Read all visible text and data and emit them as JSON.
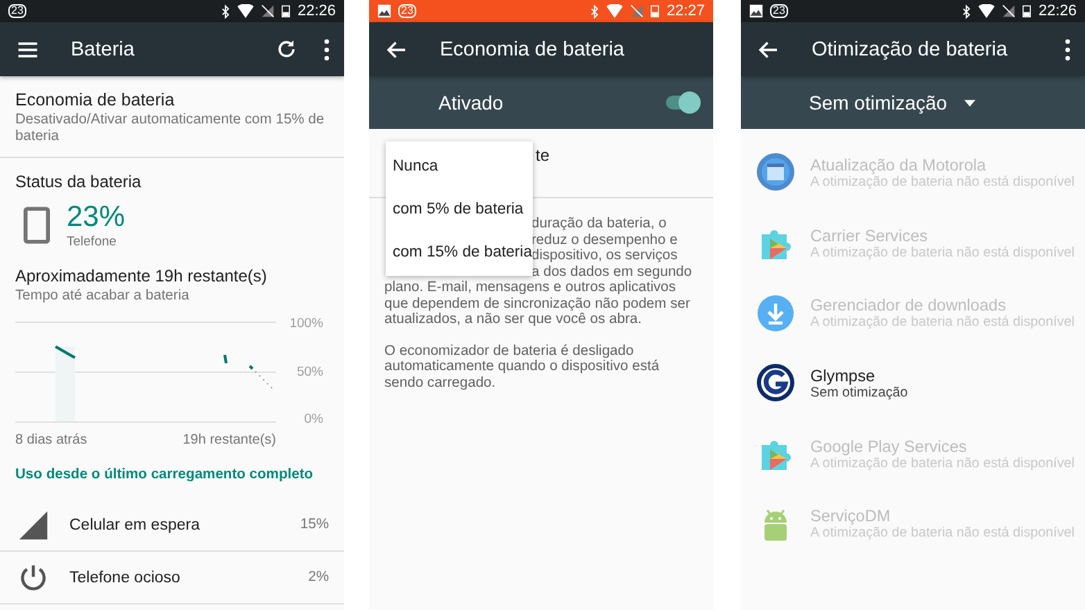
{
  "screens": [
    {
      "kind": "battery",
      "status_bar": {
        "saver": false,
        "notifications": [
          {
            "kind": "count",
            "text": "23"
          }
        ],
        "time": "22:26"
      },
      "app_bar": {
        "nav": {
          "kind": "menu"
        },
        "title": "Bateria",
        "actions": [
          {
            "kind": "refresh"
          },
          {
            "kind": "more"
          }
        ]
      },
      "saver_item": {
        "title": "Economia de bateria",
        "subtitle": "Desativado/Ativar automaticamente com 15% de bateria"
      },
      "status": {
        "heading": "Status da bateria",
        "percent": "23%",
        "device": "Telefone"
      },
      "remaining": {
        "title": "Aproximadamente 19h restante(s)",
        "subtitle": "Tempo até acabar a bateria"
      },
      "graph": {
        "y_labels": [
          "100%",
          "50%",
          "0%"
        ],
        "x_labels": [
          "8 dias atrás",
          "19h restante(s)"
        ]
      },
      "usage_heading": "Uso desde o último carregamento completo",
      "usage": [
        {
          "kind": "signal",
          "name": "Celular em espera",
          "percent": "15%"
        },
        {
          "kind": "power",
          "name": "Telefone ocioso",
          "percent": "2%"
        }
      ]
    },
    {
      "kind": "saver",
      "status_bar": {
        "saver": true,
        "notifications": [
          {
            "kind": "image"
          },
          {
            "kind": "count",
            "text": "23"
          }
        ],
        "time": "22:27"
      },
      "app_bar": {
        "nav": {
          "kind": "back"
        },
        "title": "Economia de bateria"
      },
      "master": {
        "label": "Ativado",
        "on": true
      },
      "row_fragment": "te",
      "paragraph_fragments": [
        "duração da bateria, o",
        "reduz o desempenho e",
        "dispositivo, os serviços",
        "a dos dados em segundo"
      ],
      "paragraph_rest": [
        "plano. E-mail, mensagens e outros aplicativos",
        "que dependem de sincronização não podem ser",
        "atualizados, a não ser que você os abra."
      ],
      "paragraph2": "O economizador de bateria é desligado automaticamente quando o dispositivo está sendo carregado.",
      "menu": [
        "Nunca",
        "com 5% de bateria",
        "com 15% de bateria"
      ]
    },
    {
      "kind": "optimization",
      "status_bar": {
        "saver": false,
        "notifications": [
          {
            "kind": "image"
          },
          {
            "kind": "count",
            "text": "23"
          }
        ],
        "time": "22:26"
      },
      "app_bar": {
        "nav": {
          "kind": "back"
        },
        "title": "Otimização de bateria",
        "actions": [
          {
            "kind": "more"
          }
        ]
      },
      "filter": "Sem otimização",
      "apps": [
        {
          "kind": "window",
          "name": "Atualização da Motorola",
          "status": "A otimização de bateria não está disponível",
          "disabled": true
        },
        {
          "kind": "puzzle",
          "name": "Carrier Services",
          "status": "A otimização de bateria não está disponível",
          "disabled": true
        },
        {
          "kind": "download",
          "name": "Gerenciador de downloads",
          "status": "A otimização de bateria não está disponível",
          "disabled": true
        },
        {
          "kind": "g-letter",
          "name": "Glympse",
          "status": "Sem otimização",
          "disabled": false
        },
        {
          "kind": "puzzle",
          "name": "Google Play Services",
          "status": "A otimização de bateria não está disponível",
          "disabled": true
        },
        {
          "kind": "robot",
          "name": "ServiçoDM",
          "status": "A otimização de bateria não está disponível",
          "disabled": true
        }
      ]
    }
  ]
}
